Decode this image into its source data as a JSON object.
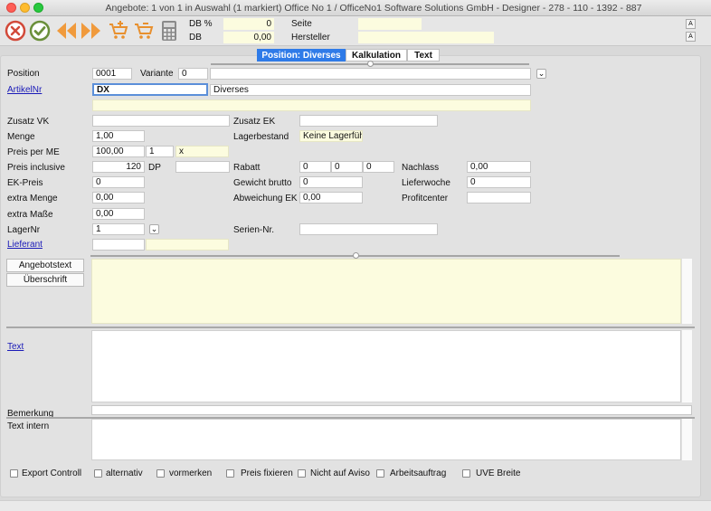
{
  "window": {
    "title": "Angebote: 1 von 1 in Auswahl  (1 markiert) Office No 1 /  OfficeNo1 Software Solutions GmbH - Designer - 278 - 110 - 1392 - 887"
  },
  "header": {
    "db_pct_label": "DB %",
    "db_pct_value": "0",
    "db_label": "DB",
    "db_value": "0,00",
    "seite_label": "Seite",
    "seite_value": "",
    "hersteller_label": "Hersteller",
    "hersteller_value": ""
  },
  "toolbar": {
    "icons": [
      "cancel-icon",
      "ok-icon",
      "prev-icon",
      "next-icon",
      "cart-add-icon",
      "cart-remove-icon",
      "calculator-icon"
    ]
  },
  "tabs": [
    {
      "label": "Position: Diverses",
      "active": true
    },
    {
      "label": "Kalkulation",
      "active": false
    },
    {
      "label": "Text",
      "active": false
    }
  ],
  "form": {
    "position_label": "Position",
    "position_value": "0001",
    "variante_label": "Variante",
    "variante_value": "0",
    "variante_text": "",
    "artikelnr_label": "ArtikelNr",
    "artikelnr_value": "DX",
    "artikel_desc": "Diverses",
    "artikel_desc2": "",
    "zusatz_vk_label": "Zusatz VK",
    "zusatz_vk_value": "",
    "zusatz_ek_label": "Zusatz EK",
    "zusatz_ek_value": "",
    "menge_label": "Menge",
    "menge_value": "1,00",
    "lagerbestand_label": "Lagerbestand",
    "lagerbestand_value": "Keine Lagerführ",
    "preis_me_label": "Preis per ME",
    "preis_me_value": "100,00",
    "preis_me_qty": "1",
    "preis_me_x": "x",
    "preis_incl_label": "Preis inclusive",
    "preis_incl_value": "120",
    "dp_label": "DP",
    "dp_value": "",
    "rabatt_label": "Rabatt",
    "rabatt_1": "0",
    "rabatt_2": "0",
    "rabatt_3": "0",
    "nachlass_label": "Nachlass",
    "nachlass_value": "0,00",
    "ek_preis_label": "EK-Preis",
    "ek_preis_value": "0",
    "gewicht_label": "Gewicht brutto",
    "gewicht_value": "0",
    "lieferwoche_label": "Lieferwoche",
    "lieferwoche_value": "0",
    "extra_menge_label": "extra Menge",
    "extra_menge_value": "0,00",
    "abweichung_label": "Abweichung EK",
    "abweichung_value": "0,00",
    "profitcenter_label": "Profitcenter",
    "profitcenter_value": "",
    "extra_masse_label": "extra Maße",
    "extra_masse_value": "0,00",
    "lagernr_label": "LagerNr",
    "lagernr_value": "1",
    "seriennr_label": "Serien-Nr.",
    "seriennr_value": "",
    "lieferant_label": "Lieferant",
    "lieferant_value": "",
    "lieferant_name": ""
  },
  "texts": {
    "angebotstext_btn": "Angebotstext",
    "ueberschrift_btn": "Überschrift",
    "text_link": "Text",
    "bemerkung_label": "Bemerkung",
    "text_intern_label": "Text intern"
  },
  "checkboxes": [
    {
      "label": "Export Controll"
    },
    {
      "label": "alternativ"
    },
    {
      "label": "vormerken"
    },
    {
      "label": "Preis fixieren"
    },
    {
      "label": "Nicht auf Aviso"
    },
    {
      "label": "Arbeitsauftrag"
    },
    {
      "label": "UVE Breite"
    }
  ]
}
